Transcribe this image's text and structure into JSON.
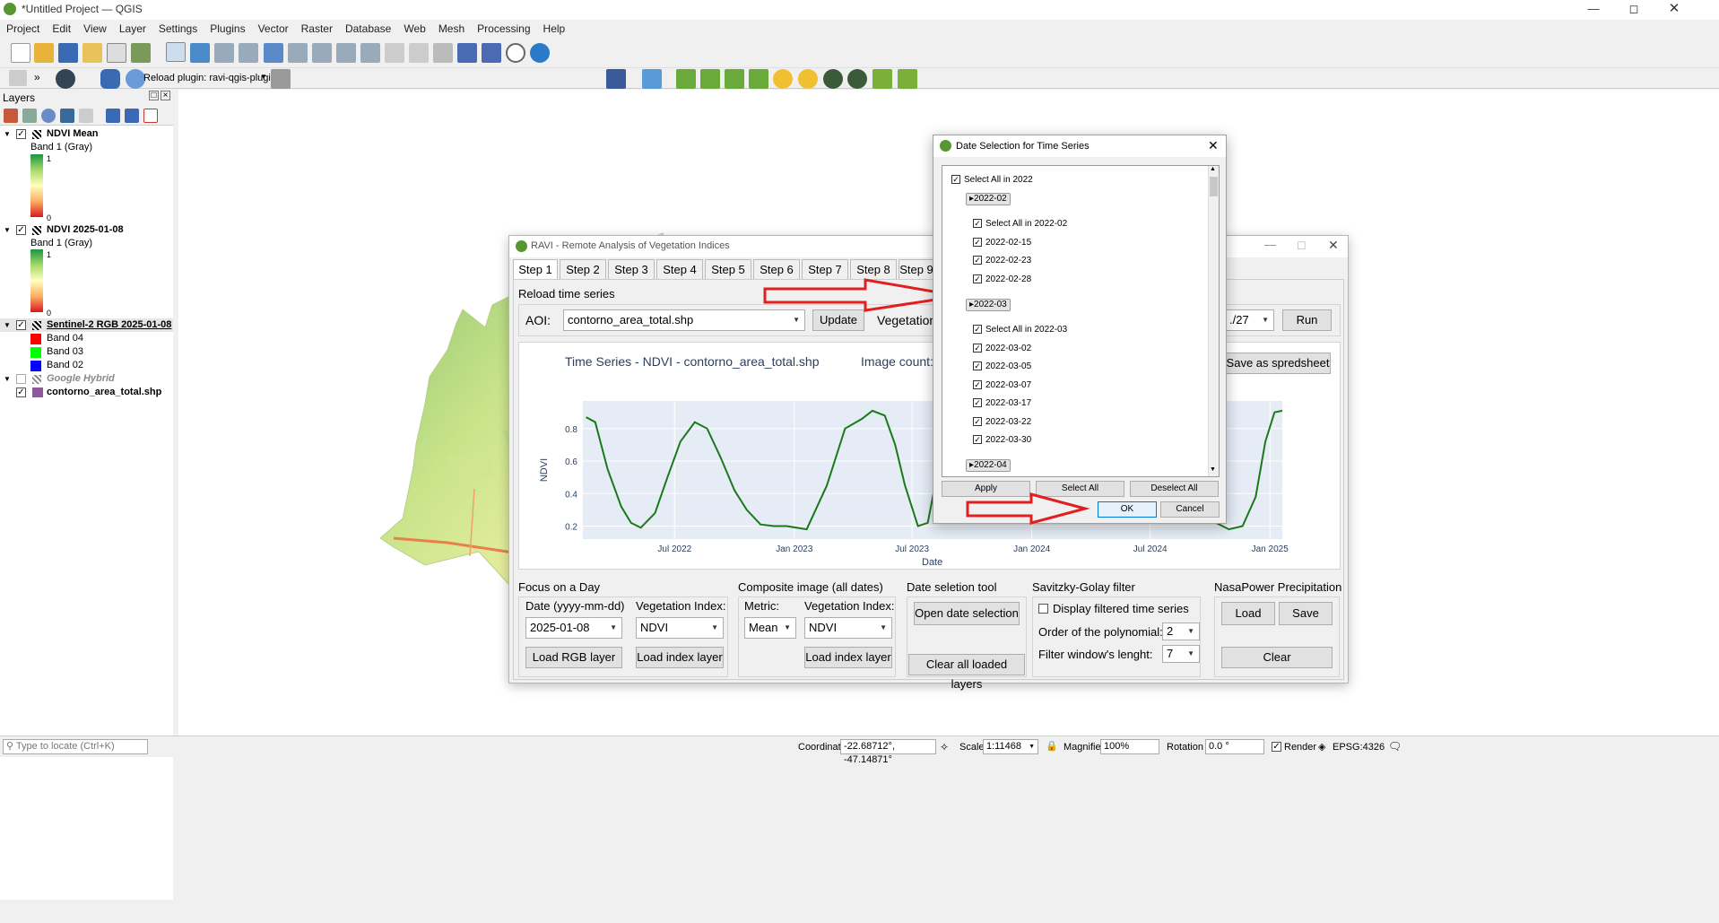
{
  "window": {
    "title": "*Untitled Project — QGIS"
  },
  "menu": [
    "Project",
    "Edit",
    "View",
    "Layer",
    "Settings",
    "Plugins",
    "Vector",
    "Raster",
    "Database",
    "Web",
    "Mesh",
    "Processing",
    "Help"
  ],
  "toolbar2": {
    "reload_label": "Reload plugin: ravi-qgis-plugin",
    "chevrons": "»"
  },
  "layers_panel": {
    "title": "Layers",
    "items": [
      {
        "name": "NDVI Mean",
        "sub": "Band 1 (Gray)",
        "max": "1",
        "min": "0"
      },
      {
        "name": "NDVI 2025-01-08",
        "sub": "Band 1 (Gray)",
        "max": "1",
        "min": "0"
      },
      {
        "name": "Sentinel-2 RGB 2025-01-08",
        "bands": [
          "Band 04",
          "Band 03",
          "Band 02"
        ]
      },
      {
        "name": "Google Hybrid"
      },
      {
        "name": "contorno_area_total.shp"
      }
    ]
  },
  "statusbar": {
    "locate_placeholder": "Type to locate (Ctrl+K)",
    "coordinate_label": "Coordinate",
    "coordinate_value": "-22.68712°, -47.14871°",
    "scale_label": "Scale",
    "scale_value": "1:11468",
    "magnifier_label": "Magnifier",
    "magnifier_value": "100%",
    "rotation_label": "Rotation",
    "rotation_value": "0.0 °",
    "render_label": "Render",
    "crs": "EPSG:4326"
  },
  "ravi": {
    "title": "RAVI - Remote Analysis of Vegetation Indices",
    "tabs": [
      "Step 1",
      "Step 2",
      "Step 3",
      "Step 4",
      "Step 5",
      "Step 6",
      "Step 7",
      "Step 8",
      "Step 9"
    ],
    "reload_label": "Reload time series",
    "aoi_label": "AOI:",
    "aoi_value": "contorno_area_total.shp",
    "update_label": "Update",
    "vegetation_label": "Vegetation",
    "date_partial": "./27",
    "run_label": "Run",
    "chart_title": "Time Series - NDVI - contorno_area_total.shp",
    "image_count_label": "Image count:",
    "save_spreadsheet": "Save as spredsheet",
    "focus": {
      "title": "Focus on a Day",
      "date_label": "Date (yyyy-mm-dd)",
      "date_value": "2025-01-08",
      "vi_label": "Vegetation Index:",
      "vi_value": "NDVI",
      "load_rgb": "Load RGB layer",
      "load_index": "Load index layer"
    },
    "composite": {
      "title": "Composite image (all dates)",
      "metric_label": "Metric:",
      "vi_label": "Vegetation Index:",
      "metric_value": "Mean",
      "vi_value": "NDVI",
      "load_index": "Load index layer"
    },
    "date_tool": {
      "title": "Date seletion tool",
      "open_btn": "Open date selection",
      "clear_btn": "Clear all loaded layers"
    },
    "savgol": {
      "title": "Savitzky-Golay filter",
      "display_label": "Display filtered time series",
      "poly_label": "Order of the polynomial:",
      "poly_value": "2",
      "window_label": "Filter window's lenght:",
      "window_value": "7"
    },
    "nasa": {
      "title": "NasaPower Precipitation",
      "load": "Load",
      "save": "Save",
      "clear": "Clear"
    }
  },
  "dialog": {
    "title": "Date Selection for Time Series",
    "select_all_year": "Select All in 2022",
    "groups": [
      {
        "label": "2022-02",
        "select_all": "Select All in 2022-02",
        "dates": [
          "2022-02-15",
          "2022-02-23",
          "2022-02-28"
        ]
      },
      {
        "label": "2022-03",
        "select_all": "Select All in 2022-03",
        "dates": [
          "2022-03-02",
          "2022-03-05",
          "2022-03-07",
          "2022-03-17",
          "2022-03-22",
          "2022-03-30"
        ]
      },
      {
        "label": "2022-04"
      }
    ],
    "apply": "Apply",
    "select_all": "Select All",
    "deselect_all": "Deselect All",
    "ok": "OK",
    "cancel": "Cancel"
  },
  "chart_data": {
    "type": "line",
    "title": "",
    "xlabel": "Date",
    "ylabel": "NDVI",
    "x_ticks": [
      "Jul 2022",
      "Jan 2023",
      "Jul 2023",
      "Jan 2024",
      "Jul 2024",
      "Jan 2025"
    ],
    "y_ticks": [
      "0.2",
      "0.4",
      "0.6",
      "0.8"
    ],
    "ylim": [
      0.12,
      0.97
    ],
    "xlim": [
      "2022-02-10",
      "2025-01-20"
    ],
    "series": [
      {
        "color": "#1a7a1a",
        "x": [
          "2022-02-15",
          "2022-03-01",
          "2022-03-20",
          "2022-04-10",
          "2022-04-25",
          "2022-05-10",
          "2022-06-01",
          "2022-06-20",
          "2022-07-10",
          "2022-08-01",
          "2022-08-20",
          "2022-09-10",
          "2022-10-01",
          "2022-10-20",
          "2022-11-10",
          "2022-12-01",
          "2022-12-20",
          "2023-01-20",
          "2023-02-20",
          "2023-03-20",
          "2023-04-15",
          "2023-05-01",
          "2023-05-20",
          "2023-06-05",
          "2023-06-20",
          "2023-07-10",
          "2023-07-25",
          "2023-08-10",
          "2023-08-25"
        ],
        "y": [
          0.87,
          0.84,
          0.55,
          0.32,
          0.22,
          0.19,
          0.28,
          0.5,
          0.72,
          0.84,
          0.8,
          0.62,
          0.42,
          0.3,
          0.21,
          0.2,
          0.2,
          0.18,
          0.45,
          0.8,
          0.86,
          0.91,
          0.88,
          0.7,
          0.45,
          0.2,
          0.22,
          0.55,
          0.75
        ]
      },
      {
        "color": "#1a7a1a",
        "x": [
          "2023-08-25",
          "2023-09-10",
          "2023-10-01",
          "2023-10-20",
          "2023-11-10",
          "2023-11-25",
          "2023-12-05"
        ],
        "y": [
          0.75,
          0.8,
          0.81,
          0.8,
          0.78,
          0.77,
          0.7
        ]
      },
      {
        "color": "#1a7a1a",
        "x": [
          "2024-09-20",
          "2024-10-10",
          "2024-10-30",
          "2024-11-20",
          "2024-12-10",
          "2024-12-25",
          "2025-01-08",
          "2025-01-20"
        ],
        "y": [
          0.35,
          0.22,
          0.18,
          0.2,
          0.38,
          0.72,
          0.9,
          0.91
        ]
      }
    ]
  }
}
